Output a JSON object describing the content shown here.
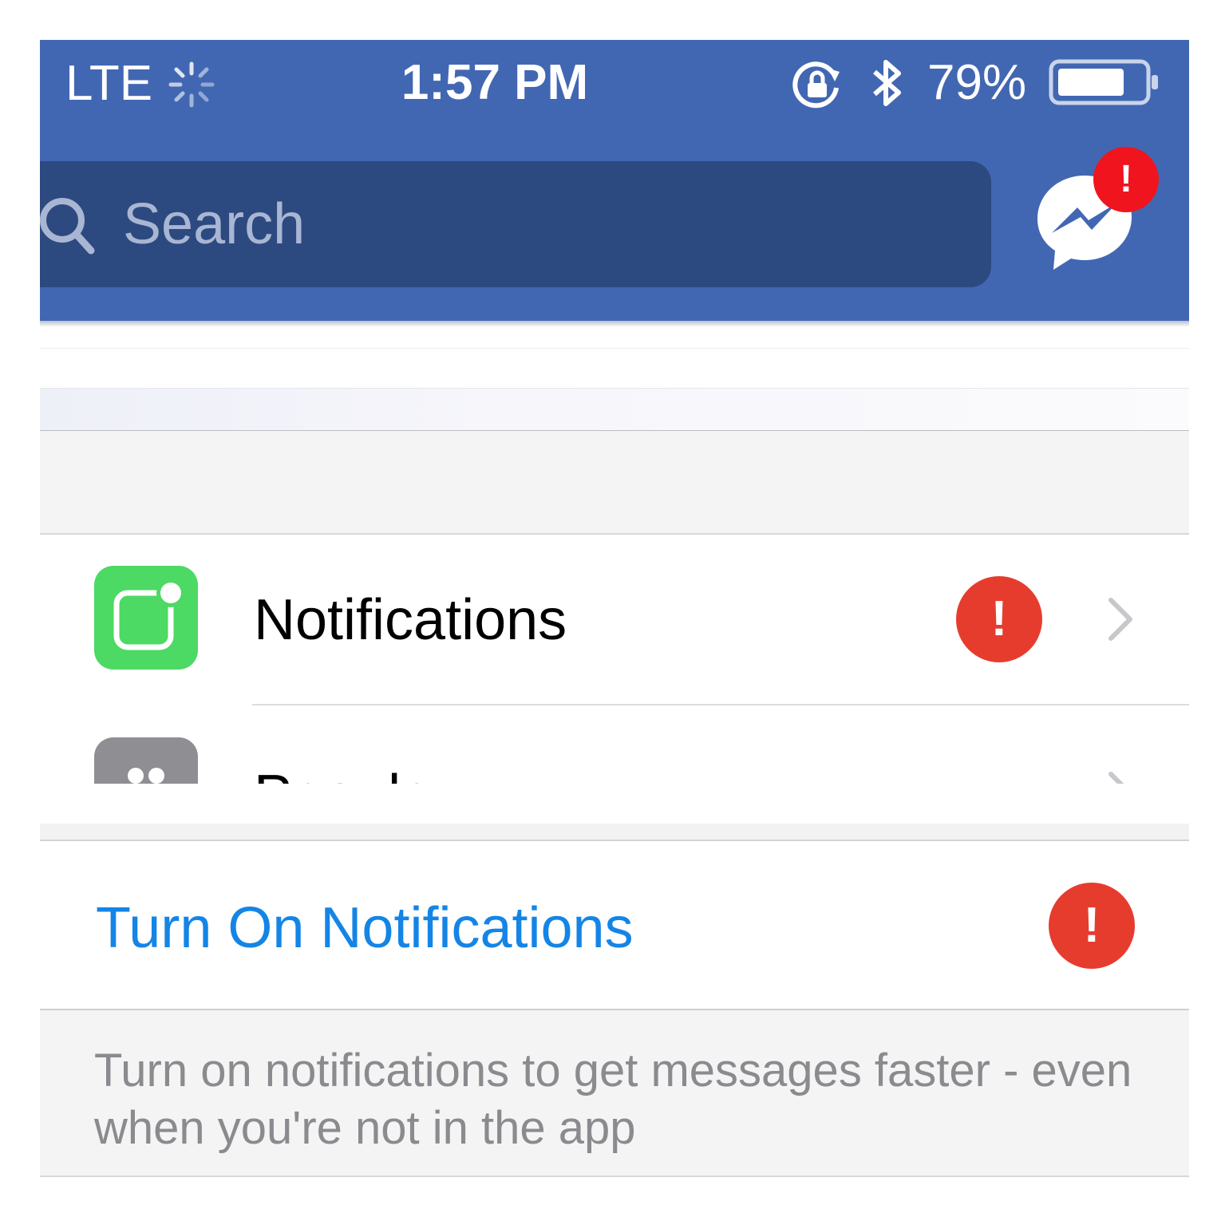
{
  "status_bar": {
    "carrier": "LTE",
    "time": "1:57 PM",
    "battery_percent": "79%",
    "battery_level": 0.79,
    "icons": [
      "activity-spinner-icon",
      "rotation-lock-icon",
      "bluetooth-icon",
      "battery-icon"
    ]
  },
  "header": {
    "search_placeholder": "Search",
    "messenger_badge": "!",
    "colors": {
      "bar": "#4267b2",
      "search_box": "#2c4a80",
      "badge": "#f0141e"
    }
  },
  "settings": {
    "rows": [
      {
        "label": "Notifications",
        "badge": "!",
        "icon": "notification-app-icon",
        "icon_color": "#4cd964"
      },
      {
        "label": "People",
        "icon": "people-icon",
        "icon_color": "#8e8e93"
      }
    ]
  },
  "turn_on": {
    "label": "Turn On Notifications",
    "badge": "!",
    "label_color": "#1485e6",
    "footer": "Turn on notifications to get messages faster - even when you're not in the app"
  }
}
